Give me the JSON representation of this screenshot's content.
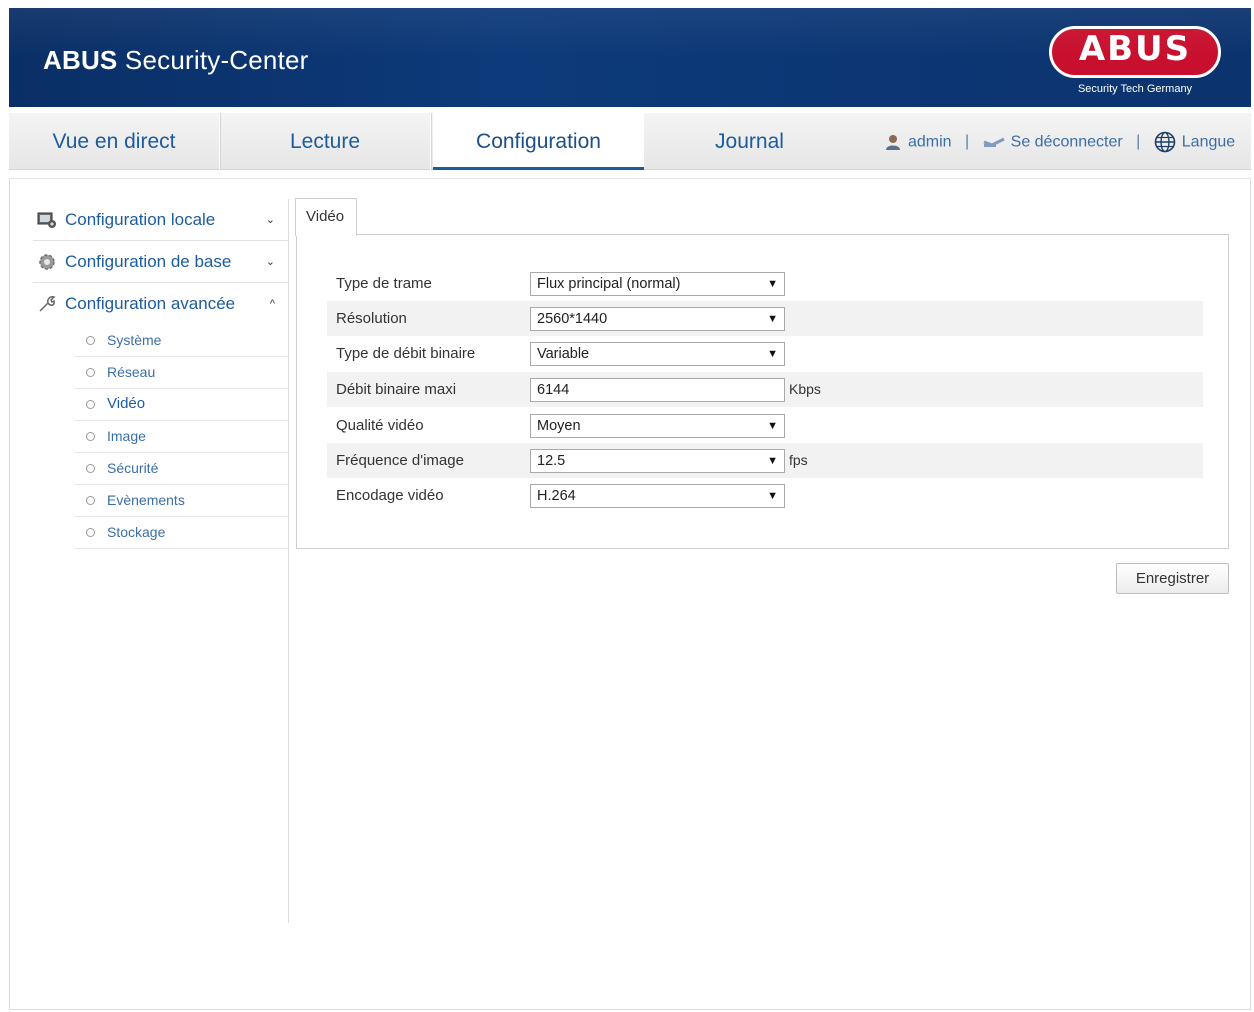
{
  "header": {
    "brand": "ABUS",
    "app_name": "Security-Center",
    "logo_text": "ABUS",
    "logo_tagline": "Security Tech Germany"
  },
  "nav": {
    "tabs": [
      {
        "label": "Vue en direct"
      },
      {
        "label": "Lecture"
      },
      {
        "label": "Configuration"
      },
      {
        "label": "Journal"
      }
    ],
    "active_tab": "Configuration",
    "user": "admin",
    "logout": "Se déconnecter",
    "language": "Langue",
    "separator": "|"
  },
  "sidebar": {
    "groups": [
      {
        "label": "Configuration locale",
        "chevron": "⌄"
      },
      {
        "label": "Configuration de base",
        "chevron": "⌄"
      },
      {
        "label": "Configuration avancée",
        "chevron": "^"
      }
    ],
    "sub_items": [
      {
        "label": "Système"
      },
      {
        "label": "Réseau"
      },
      {
        "label": "Vidéo"
      },
      {
        "label": "Image"
      },
      {
        "label": "Sécurité"
      },
      {
        "label": "Evènements"
      },
      {
        "label": "Stockage"
      }
    ],
    "active_item": "Vidéo"
  },
  "main": {
    "tab": "Vidéo",
    "rows": [
      {
        "label": "Type de trame",
        "value": "Flux principal (normal)",
        "unit": ""
      },
      {
        "label": "Résolution",
        "value": "2560*1440",
        "unit": ""
      },
      {
        "label": "Type de débit binaire",
        "value": "Variable",
        "unit": ""
      },
      {
        "label": "Débit binaire maxi",
        "value": "6144",
        "unit": "Kbps"
      },
      {
        "label": "Qualité vidéo",
        "value": "Moyen",
        "unit": ""
      },
      {
        "label": "Fréquence d'image",
        "value": "12.5",
        "unit": "fps"
      },
      {
        "label": "Encodage vidéo",
        "value": "H.264",
        "unit": ""
      }
    ],
    "dropdown_arrow": "▼",
    "save_label": "Enregistrer"
  },
  "colors": {
    "header_blue": "#0d3a7a",
    "link_blue": "#1c5c9e",
    "logo_red": "#c8102e"
  }
}
